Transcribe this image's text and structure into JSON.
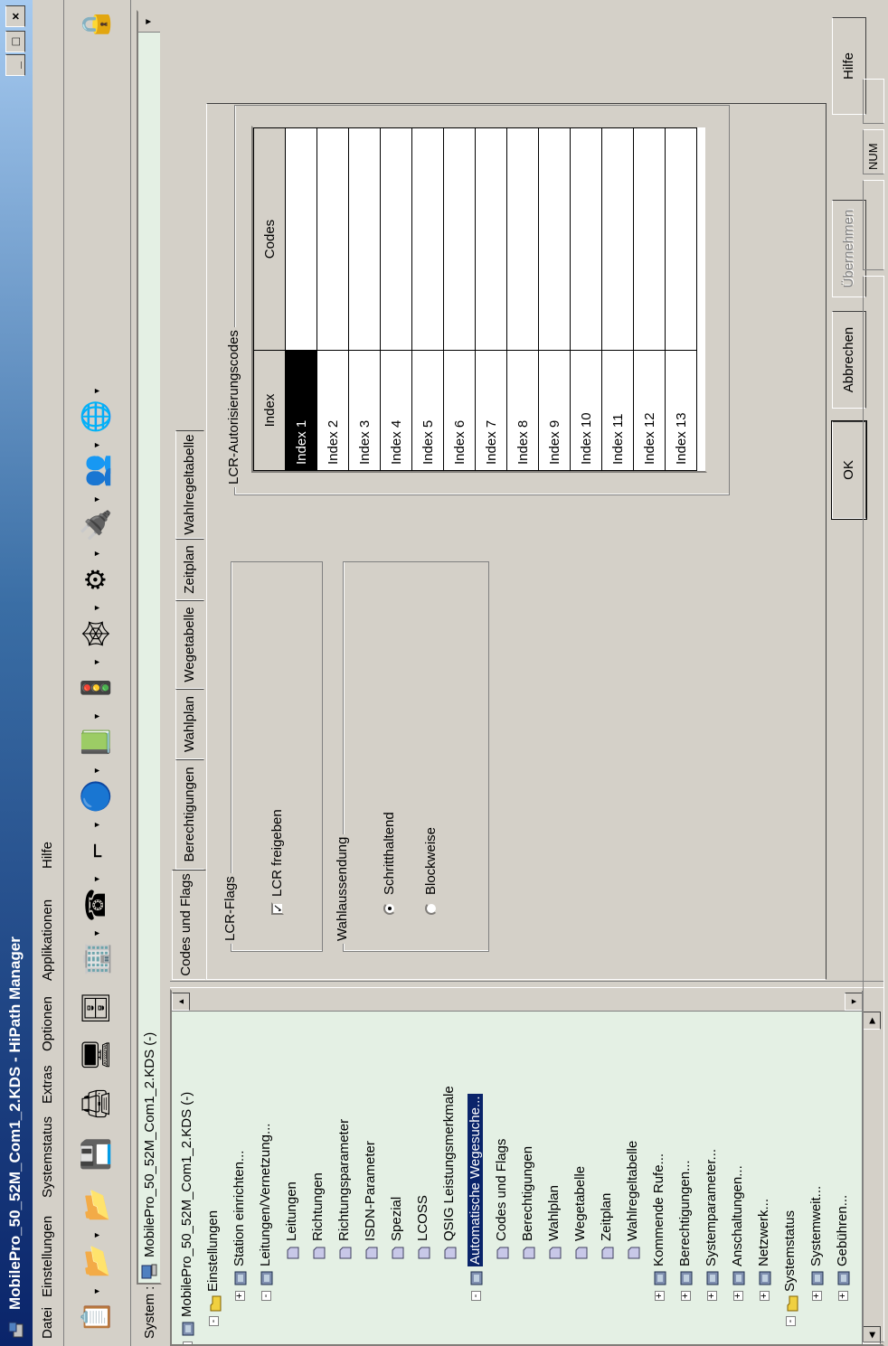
{
  "window": {
    "title": "MobilePro_50_52M_Com1_2.KDS - HiPath Manager",
    "controls": [
      "minimize",
      "maximize",
      "close"
    ]
  },
  "menu": [
    "Datei",
    "Einstellungen",
    "Systemstatus",
    "Extras",
    "Optionen",
    "Applikationen",
    "Hilfe"
  ],
  "toolbar": {
    "icons": [
      "wizard-icon",
      "new-icon",
      "open-icon",
      "save-icon",
      "print-icon",
      "terminal-icon",
      "network-icon",
      "building-icon",
      "phone-icon",
      "connect-icon",
      "transfer-icon",
      "book-icon",
      "traffic-light-icon",
      "net-icon",
      "config-icon",
      "power-icon",
      "users-icon",
      "web-icon",
      "lock-icon"
    ]
  },
  "system_bar": {
    "label": "System :",
    "value": "MobilePro_50_52M_Com1_2.KDS (-)"
  },
  "tree": {
    "items": [
      {
        "label": "MobilePro_50_52M_Com1_2.KDS (-)",
        "level": 0,
        "expander": "-"
      },
      {
        "label": "Einstellungen",
        "level": 1,
        "expander": "-"
      },
      {
        "label": "Station einrichten...",
        "level": 2,
        "expander": "+"
      },
      {
        "label": "Leitungen/Vernetzung...",
        "level": 2,
        "expander": "-"
      },
      {
        "label": "Leitungen",
        "level": 3,
        "expander": ""
      },
      {
        "label": "Richtungen",
        "level": 3,
        "expander": ""
      },
      {
        "label": "Richtungsparameter",
        "level": 3,
        "expander": ""
      },
      {
        "label": "ISDN-Parameter",
        "level": 3,
        "expander": ""
      },
      {
        "label": "Spezial",
        "level": 3,
        "expander": ""
      },
      {
        "label": "LCOSS",
        "level": 3,
        "expander": ""
      },
      {
        "label": "QSIG Leistungsmerkmale",
        "level": 3,
        "expander": ""
      },
      {
        "label": "Automatische Wegesuche...",
        "level": 2,
        "expander": "-",
        "selected": true
      },
      {
        "label": "Codes und Flags",
        "level": 3,
        "expander": ""
      },
      {
        "label": "Berechtigungen",
        "level": 3,
        "expander": ""
      },
      {
        "label": "Wahlplan",
        "level": 3,
        "expander": ""
      },
      {
        "label": "Wegetabelle",
        "level": 3,
        "expander": ""
      },
      {
        "label": "Zeitplan",
        "level": 3,
        "expander": ""
      },
      {
        "label": "Wahlregeltabelle",
        "level": 3,
        "expander": ""
      },
      {
        "label": "Kommende Rufe...",
        "level": 2,
        "expander": "+"
      },
      {
        "label": "Berechtigungen...",
        "level": 2,
        "expander": "+"
      },
      {
        "label": "Systemparameter...",
        "level": 2,
        "expander": "+"
      },
      {
        "label": "Anschaltungen...",
        "level": 2,
        "expander": "+"
      },
      {
        "label": "Netzwerk...",
        "level": 2,
        "expander": "+"
      },
      {
        "label": "Systemstatus",
        "level": 1,
        "expander": "-"
      },
      {
        "label": "Systemweit...",
        "level": 2,
        "expander": "+"
      },
      {
        "label": "Gebühren...",
        "level": 2,
        "expander": "+"
      }
    ]
  },
  "tabs": [
    "Codes und Flags",
    "Berechtigungen",
    "Wahlplan",
    "Wegetabelle",
    "Zeitplan",
    "Wahlregeltabelle"
  ],
  "active_tab": "Codes und Flags",
  "lcr_flags": {
    "title": "LCR-Flags",
    "checkbox_label": "LCR freigeben",
    "checked": true
  },
  "wahlaussendung": {
    "title": "Wahlaussendung",
    "options": [
      "Schritthaltend",
      "Blockweise"
    ],
    "selected": "Schritthaltend"
  },
  "auth_codes": {
    "title": "LCR-Autorisierungscodes",
    "columns": [
      "Index",
      "Codes"
    ],
    "rows": [
      {
        "index": "Index 1",
        "code": ""
      },
      {
        "index": "Index 2",
        "code": ""
      },
      {
        "index": "Index 3",
        "code": ""
      },
      {
        "index": "Index 4",
        "code": ""
      },
      {
        "index": "Index 5",
        "code": ""
      },
      {
        "index": "Index 6",
        "code": ""
      },
      {
        "index": "Index 7",
        "code": ""
      },
      {
        "index": "Index 8",
        "code": ""
      },
      {
        "index": "Index 9",
        "code": ""
      },
      {
        "index": "Index 10",
        "code": ""
      },
      {
        "index": "Index 11",
        "code": ""
      },
      {
        "index": "Index 12",
        "code": ""
      },
      {
        "index": "Index 13",
        "code": ""
      }
    ]
  },
  "buttons": {
    "ok": "OK",
    "cancel": "Abbrechen",
    "apply": "Übernehmen",
    "help": "Hilfe"
  },
  "status": {
    "num": "NUM"
  },
  "colors": {
    "titlebar": "#0a246a",
    "tree_bg": "#e4f0e4",
    "face": "#d4d0c8",
    "selection": "#0a246a"
  }
}
